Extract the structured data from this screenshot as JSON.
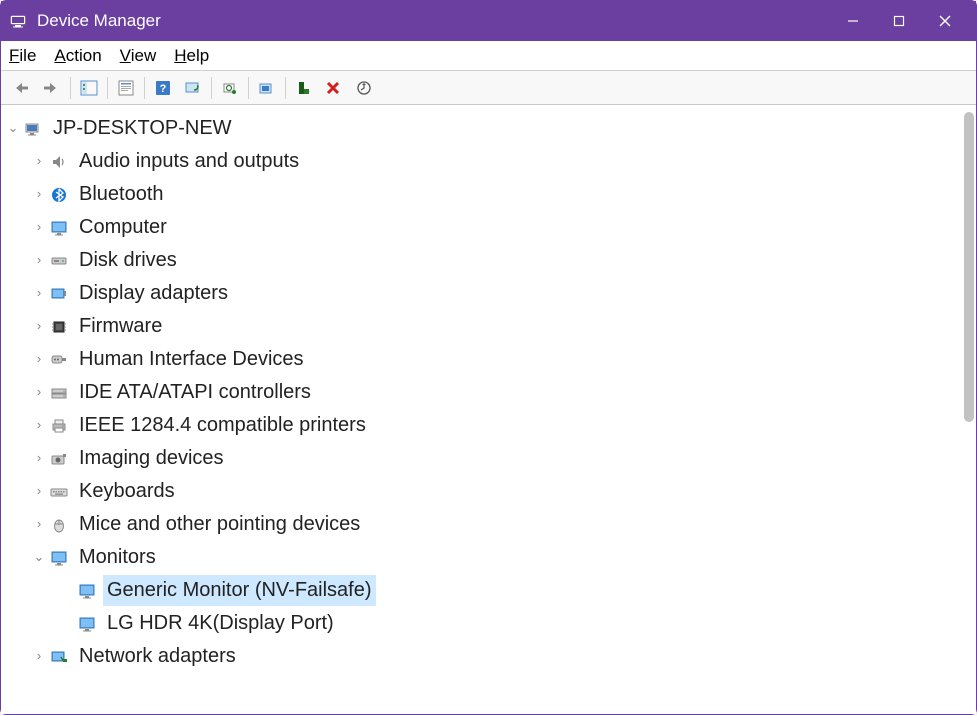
{
  "window": {
    "title": "Device Manager"
  },
  "menu": {
    "file": "File",
    "action": "Action",
    "view": "View",
    "help": "Help"
  },
  "tree": {
    "root": "JP-DESKTOP-NEW",
    "categories": [
      {
        "label": "Audio inputs and outputs",
        "icon": "speaker",
        "expanded": false
      },
      {
        "label": "Bluetooth",
        "icon": "bluetooth",
        "expanded": false
      },
      {
        "label": "Computer",
        "icon": "monitor",
        "expanded": false
      },
      {
        "label": "Disk drives",
        "icon": "disk",
        "expanded": false
      },
      {
        "label": "Display adapters",
        "icon": "display-adapter",
        "expanded": false
      },
      {
        "label": "Firmware",
        "icon": "chip",
        "expanded": false
      },
      {
        "label": "Human Interface Devices",
        "icon": "hid",
        "expanded": false
      },
      {
        "label": "IDE ATA/ATAPI controllers",
        "icon": "ide",
        "expanded": false
      },
      {
        "label": "IEEE 1284.4 compatible printers",
        "icon": "printer",
        "expanded": false
      },
      {
        "label": "Imaging devices",
        "icon": "camera",
        "expanded": false
      },
      {
        "label": "Keyboards",
        "icon": "keyboard",
        "expanded": false
      },
      {
        "label": "Mice and other pointing devices",
        "icon": "mouse",
        "expanded": false
      },
      {
        "label": "Monitors",
        "icon": "monitor",
        "expanded": true,
        "children": [
          {
            "label": "Generic Monitor (NV-Failsafe)",
            "icon": "monitor",
            "selected": true
          },
          {
            "label": "LG HDR 4K(Display Port)",
            "icon": "monitor",
            "selected": false
          }
        ]
      },
      {
        "label": "Network adapters",
        "icon": "network",
        "expanded": false
      }
    ]
  }
}
